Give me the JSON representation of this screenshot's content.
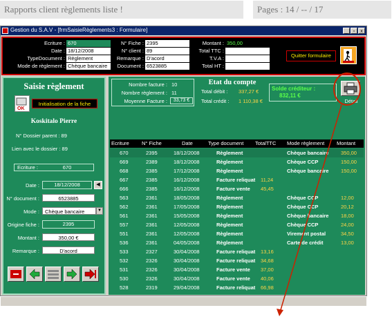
{
  "doc": {
    "left_title": "Rapports client règlements liste !",
    "right_title": "Pages : 14 / -- / 17"
  },
  "window": {
    "title": "Gestion du S.A.V - [frmSaisieRèglements3 : Formulaire]",
    "controls": [
      "_",
      "▫",
      "x"
    ]
  },
  "topbar": {
    "ecriture_label": "Ecriture :",
    "ecriture_value": "670",
    "date_label": "Date :",
    "date_value": "18/12/2008",
    "type_label": "TypeDocument :",
    "type_value": "Règlement",
    "mode_label": "Mode de règlement :",
    "mode_value": "Chèque bancaire",
    "nfiche_label": "N° Fiche :",
    "nfiche_value": "2395",
    "nclient_label": "N° client :",
    "nclient_value": "89",
    "remarque_label": "Remarque :",
    "remarque_value": "D'acord",
    "document_label": "Document :",
    "document_value": "6523885",
    "montant_label": "Montant :",
    "montant_value": "350,00",
    "ttc_label": "Total TTC :",
    "ttc_value": "",
    "tva_label": "T.V.A :",
    "tva_value": "",
    "ht_label": "Total HT :",
    "ht_value": "",
    "quit_label": "Quitter formulaire"
  },
  "left": {
    "title": "Saisie règlement",
    "init_label": "Initialisation de la fiche",
    "client_name": "Koskitalo   Pierre",
    "dossier_parent": "N° Dossier parent :  89",
    "lien_dossier": "Lien avec le dossier :  89",
    "ecriture_label": "Ecriture :",
    "ecriture_value": "670",
    "date_label": "Date :",
    "date_value": "18/12/2008",
    "ndoc_label": "N° document :",
    "ndoc_value": "6523885",
    "mode_label": "Mode :",
    "mode_value": "Chèque bancaire",
    "origine_label": "Origine fiche :",
    "origine_value": "2395",
    "montant_label": "Montant :",
    "montant_value": "350,00 €",
    "remarque_label": "Remarque :",
    "remarque_value": "D'acord"
  },
  "right": {
    "nb_facture_label": "Nombre facture :",
    "nb_facture_value": "10",
    "nb_reglement_label": "Nombre règlement :",
    "nb_reglement_value": "11",
    "moyenne_label": "Moyenne Facture :",
    "moyenne_value": "33,73 €",
    "etat_title": "Etat du compte",
    "total_debit_label": "Total débit :",
    "total_debit_value": "337,27 €",
    "total_credit_label": "Total crédit :",
    "total_credit_value": "1 110,38 €",
    "solde_label": "Solde créditeur :",
    "solde_value": "832,11 €",
    "detail_label": "Détail",
    "columns": [
      "Ecriture",
      "N° Fiche",
      "Date",
      "Type document",
      "TotalTTC",
      "Mode règlement",
      "Montant"
    ],
    "rows": [
      {
        "ecriture": "670",
        "fiche": "2395",
        "date": "18/12/2008",
        "type": "Règlement",
        "ttc": "",
        "mode": "Chèque bancaire",
        "montant": "350,00"
      },
      {
        "ecriture": "669",
        "fiche": "2389",
        "date": "18/12/2008",
        "type": "Règlement",
        "ttc": "",
        "mode": "Chèque CCP",
        "montant": "150,00"
      },
      {
        "ecriture": "668",
        "fiche": "2385",
        "date": "17/12/2008",
        "type": "Règlement",
        "ttc": "",
        "mode": "Chèque bancaire",
        "montant": "150,00"
      },
      {
        "ecriture": "667",
        "fiche": "2385",
        "date": "16/12/2008",
        "type": "Facture reliquat",
        "ttc": "11,24",
        "mode": "",
        "montant": ""
      },
      {
        "ecriture": "666",
        "fiche": "2385",
        "date": "16/12/2008",
        "type": "Facture vente",
        "ttc": "45,45",
        "mode": "",
        "montant": ""
      },
      {
        "ecriture": "563",
        "fiche": "2361",
        "date": "18/05/2008",
        "type": "Règlement",
        "ttc": "",
        "mode": "Chèque CCP",
        "montant": "12,00"
      },
      {
        "ecriture": "562",
        "fiche": "2361",
        "date": "17/05/2008",
        "type": "Règlement",
        "ttc": "",
        "mode": "Chèque CCP",
        "montant": "20,12"
      },
      {
        "ecriture": "561",
        "fiche": "2361",
        "date": "15/05/2008",
        "type": "Règlement",
        "ttc": "",
        "mode": "Chèque bancaire",
        "montant": "18,00"
      },
      {
        "ecriture": "557",
        "fiche": "2361",
        "date": "12/05/2008",
        "type": "Règlement",
        "ttc": "",
        "mode": "Chèque CCP",
        "montant": "24,00"
      },
      {
        "ecriture": "551",
        "fiche": "2361",
        "date": "12/05/2008",
        "type": "Règlement",
        "ttc": "",
        "mode": "Virement postal",
        "montant": "34,50"
      },
      {
        "ecriture": "536",
        "fiche": "2361",
        "date": "04/05/2008",
        "type": "Règlement",
        "ttc": "",
        "mode": "Carte de crédit",
        "montant": "13,00"
      },
      {
        "ecriture": "533",
        "fiche": "2327",
        "date": "30/04/2008",
        "type": "Facture reliquat",
        "ttc": "13,16",
        "mode": "",
        "montant": ""
      },
      {
        "ecriture": "532",
        "fiche": "2326",
        "date": "30/04/2008",
        "type": "Facture reliquat",
        "ttc": "34,68",
        "mode": "",
        "montant": ""
      },
      {
        "ecriture": "531",
        "fiche": "2326",
        "date": "30/04/2008",
        "type": "Facture vente",
        "ttc": "37,00",
        "mode": "",
        "montant": ""
      },
      {
        "ecriture": "530",
        "fiche": "2326",
        "date": "30/04/2008",
        "type": "Facture vente",
        "ttc": "40,06",
        "mode": "",
        "montant": ""
      },
      {
        "ecriture": "528",
        "fiche": "2319",
        "date": "29/04/2008",
        "type": "Facture reliquat",
        "ttc": "66,98",
        "mode": "",
        "montant": ""
      }
    ]
  },
  "colors": {
    "panel_green": "#1e8a5a",
    "amount_yellow": "#ffd447",
    "highlight_red": "#cc2200"
  }
}
